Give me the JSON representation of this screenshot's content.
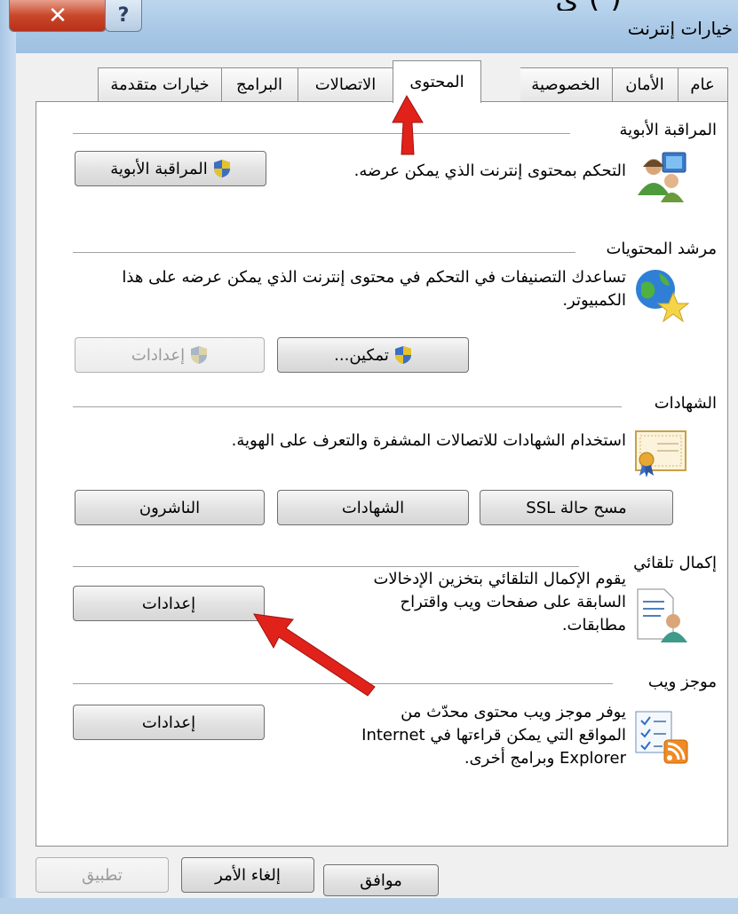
{
  "window": {
    "title": "خيارات إنترنت",
    "top_cut_text": "(   ) ي"
  },
  "tabs": [
    {
      "label": "عام"
    },
    {
      "label": "الأمان"
    },
    {
      "label": "الخصوصية"
    },
    {
      "label": "المحتوى",
      "active": true
    },
    {
      "label": "الاتصالات"
    },
    {
      "label": "البرامج"
    },
    {
      "label": "خيارات متقدمة"
    }
  ],
  "parental": {
    "heading": "المراقبة الأبوية",
    "description": "التحكم بمحتوى إنترنت الذي يمكن عرضه.",
    "button": "المراقبة الأبوية",
    "icon": "users-icon"
  },
  "advisor": {
    "heading": "مرشد المحتويات",
    "description": "تساعدك التصنيفات في التحكم في محتوى إنترنت الذي يمكن عرضه على هذا الكمبيوتر.",
    "enable_button": "تمكين...",
    "settings_button": "إعدادات",
    "icon": "globe-star-icon"
  },
  "certificates": {
    "heading": "الشهادات",
    "description": "استخدام الشهادات للاتصالات المشفرة والتعرف على الهوية.",
    "clear_ssl_button": "مسح حالة SSL",
    "certificates_button": "الشهادات",
    "publishers_button": "الناشرون",
    "icon": "certificate-icon"
  },
  "autocomplete": {
    "heading": "إكمال تلقائي",
    "description": "يقوم الإكمال التلقائي بتخزين الإدخالات السابقة على صفحات ويب واقتراح مطابقات.",
    "settings_button": "إعدادات",
    "icon": "document-user-icon"
  },
  "feeds": {
    "heading": "موجز ويب",
    "description": "يوفر موجز ويب محتوى محدّث من المواقع التي يمكن قراءتها في Internet Explorer وبرامج أخرى.",
    "settings_button": "إعدادات",
    "icon": "feed-icon"
  },
  "footer": {
    "ok": "موافق",
    "cancel": "إلغاء الأمر",
    "apply": "تطبيق"
  },
  "colors": {
    "annotation_arrow": "#e0221b"
  }
}
